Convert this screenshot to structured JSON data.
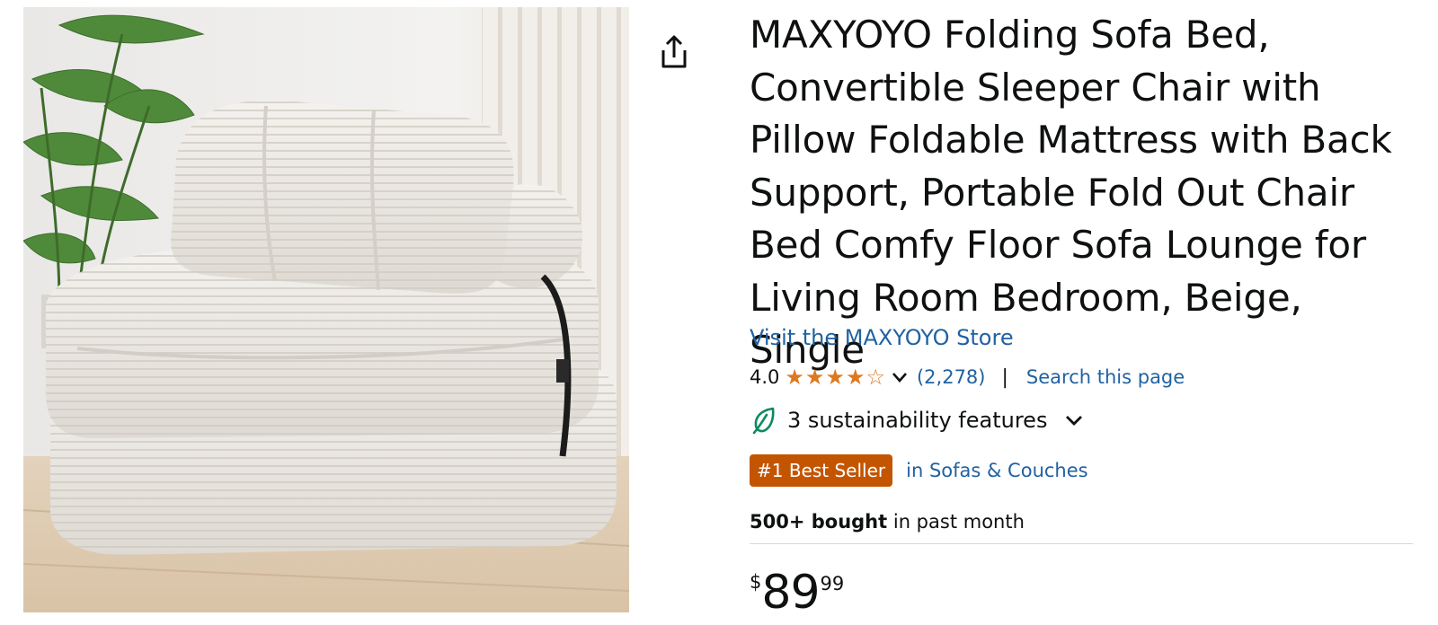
{
  "product": {
    "image_alt": "MAXYOYO folding sofa bed in beige corduroy with pillow",
    "title": "MAXYOYO Folding Sofa Bed, Convertible Sleeper Chair with Pillow Foldable Mattress with Back Support, Portable Fold Out Chair Bed Comfy Floor Sofa Lounge for Living Room Bedroom, Beige, Single",
    "store_link": "Visit the MAXYOYO Store",
    "share_icon": "share-icon"
  },
  "rating": {
    "value": "4.0",
    "stars_filled": 4,
    "stars_total": 5,
    "count": "(2,278)",
    "separator": "|",
    "search_link": "Search this page"
  },
  "sustainability": {
    "label": "3 sustainability features",
    "icon": "leaf-icon"
  },
  "badge": {
    "label": "#1 Best Seller",
    "category": "in Sofas & Couches"
  },
  "bought": {
    "count": "500+ bought",
    "suffix": " in past month"
  },
  "price": {
    "symbol": "$",
    "whole": "89",
    "fraction": "99"
  },
  "colors": {
    "link": "#2162a1",
    "star": "#de7921",
    "badge_bg": "#c45500",
    "text": "#0f1111"
  }
}
